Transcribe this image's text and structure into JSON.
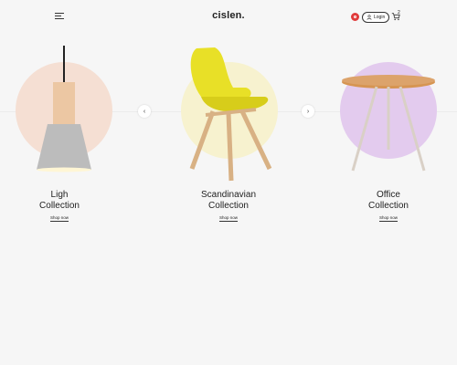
{
  "header": {
    "logo": "cislen.",
    "login_label": "Login",
    "cart_count": "2"
  },
  "products": [
    {
      "title_line1": "Ligh",
      "title_line2": "Collection",
      "shop_label": "Shop now",
      "circle_color": "#f5dfd3"
    },
    {
      "title_line1": "Scandinavian",
      "title_line2": "Collection",
      "shop_label": "Shop now",
      "circle_color": "#f7f2cf"
    },
    {
      "title_line1": "Office",
      "title_line2": "Collection",
      "shop_label": "Shop now",
      "circle_color": "#e3cbee"
    }
  ],
  "icons": {
    "menu": "hamburger-menu-icon",
    "lang": "language-icon",
    "user": "user-icon",
    "cart": "cart-icon",
    "prev": "chevron-left-icon",
    "next": "chevron-right-icon"
  },
  "colors": {
    "background": "#f6f6f6",
    "badge": "#e03b3b",
    "chair": "#e8e027"
  }
}
